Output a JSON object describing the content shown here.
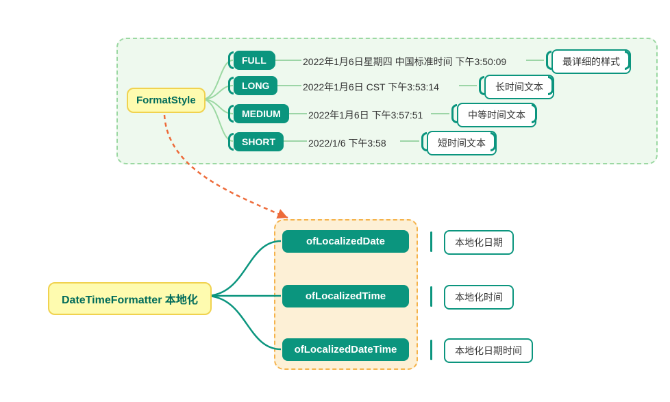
{
  "root": {
    "title": "DateTimeFormatter 本地化"
  },
  "localizedMethods": [
    {
      "name": "ofLocalizedDate",
      "note": "本地化日期"
    },
    {
      "name": "ofLocalizedTime",
      "note": "本地化时间"
    },
    {
      "name": "ofLocalizedDateTime",
      "note": "本地化日期时间"
    }
  ],
  "formatStyle": {
    "title": "FormatStyle",
    "items": [
      {
        "name": "FULL",
        "example": "2022年1月6日星期四 中国标准时间 下午3:50:09",
        "note": "最详细的样式"
      },
      {
        "name": "LONG",
        "example": "2022年1月6日 CST 下午3:53:14",
        "note": "长时间文本"
      },
      {
        "name": "MEDIUM",
        "example": "2022年1月6日 下午3:57:51",
        "note": "中等时间文本"
      },
      {
        "name": "SHORT",
        "example": "2022/1/6 下午3:58",
        "note": "短时间文本"
      }
    ]
  }
}
